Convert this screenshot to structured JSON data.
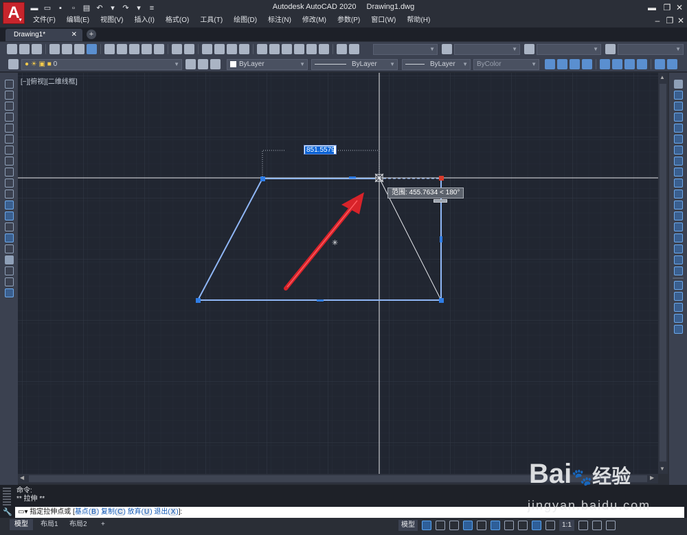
{
  "app": {
    "logo_letter": "A",
    "title": "Autodesk AutoCAD 2020",
    "document": "Drawing1.dwg"
  },
  "menu": [
    "文件(F)",
    "编辑(E)",
    "视图(V)",
    "插入(I)",
    "格式(O)",
    "工具(T)",
    "绘图(D)",
    "标注(N)",
    "修改(M)",
    "参数(P)",
    "窗口(W)",
    "帮助(H)"
  ],
  "tabs": {
    "active": "Drawing1*",
    "close_glyph": "✕",
    "add_glyph": "+"
  },
  "properties_bar": {
    "layer": "0",
    "color": "ByLayer",
    "linetype": "ByLayer",
    "lineweight": "ByLayer",
    "plotstyle": "ByColor"
  },
  "viewport": {
    "label": "[−][俯视][二维线框]",
    "dynamic_input_value": "851.5579",
    "tooltip": "范围: 455.7634 < 180°"
  },
  "command": {
    "history": [
      "命令:",
      "** 拉伸 **"
    ],
    "prompt": "指定拉伸点或",
    "options": [
      {
        "text": "基点",
        "key": "B"
      },
      {
        "text": "复制",
        "key": "C"
      },
      {
        "text": "放弃",
        "key": "U"
      },
      {
        "text": "退出",
        "key": "X"
      }
    ],
    "suffix": ":"
  },
  "status": {
    "layout_tabs": [
      "模型",
      "布局1",
      "布局2"
    ],
    "model_label": "模型",
    "scale": "1:1"
  },
  "watermark": {
    "brand": "Bai",
    "brand2": "经验",
    "url": "jingyan.baidu.com"
  },
  "colors": {
    "canvas_bg": "#212631",
    "shape_line": "#8fb6f5",
    "grip": "#2f7de6",
    "arrow": "#d8232a"
  }
}
